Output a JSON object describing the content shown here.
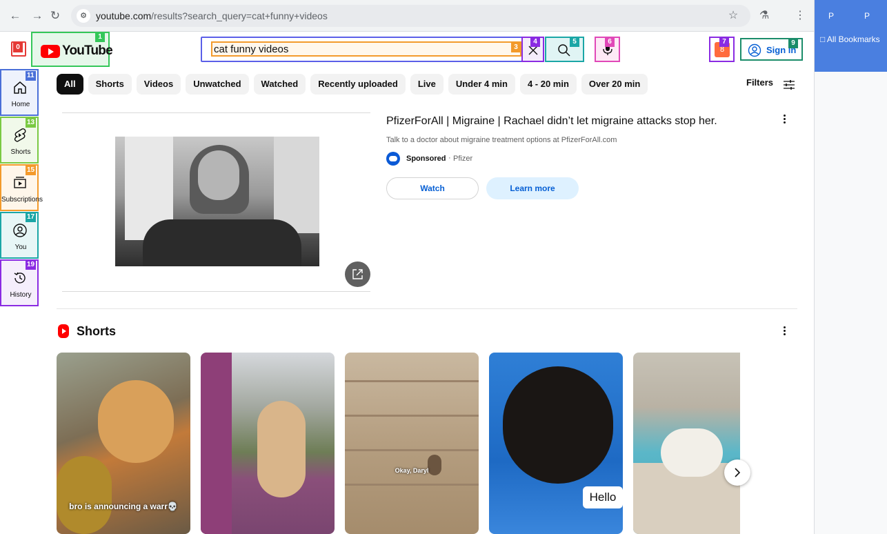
{
  "browser": {
    "url_host": "youtube.com",
    "url_path": "/results?search_query=cat+funny+videos",
    "side_panel": {
      "p_label_1": "P",
      "p_label_2": "P",
      "all_bookmarks": "All Bookmarks"
    }
  },
  "masthead": {
    "logo_text": "YouTube",
    "search": {
      "value": "cat funny videos",
      "placeholder": "Search"
    },
    "signin_label": "Sign in",
    "create_badge_label": "8"
  },
  "badges": {
    "hamburger": "0",
    "logo": "1",
    "search_input": "3",
    "clear": "4",
    "search_btn": "5",
    "mic": "6",
    "create": "7",
    "signin": "9",
    "home": "11",
    "shorts": "13",
    "subscriptions": "15",
    "you": "17",
    "history": "19"
  },
  "guide": {
    "items": [
      {
        "label": "Home",
        "icon": "home-icon"
      },
      {
        "label": "Shorts",
        "icon": "shorts-icon"
      },
      {
        "label": "Subscriptions",
        "icon": "subscriptions-icon"
      },
      {
        "label": "You",
        "icon": "you-icon"
      },
      {
        "label": "History",
        "icon": "history-icon"
      }
    ]
  },
  "chips": [
    "All",
    "Shorts",
    "Videos",
    "Unwatched",
    "Watched",
    "Recently uploaded",
    "Live",
    "Under 4 min",
    "4 - 20 min",
    "Over 20 min"
  ],
  "filters_label": "Filters",
  "ad": {
    "title": "PfizerForAll | Migraine | Rachael didn’t let migraine attacks stop her.",
    "description": "Talk to a doctor about migraine treatment options at PfizerForAll.com",
    "sponsored_label": "Sponsored",
    "separator": "·",
    "advertiser": "Pfizer",
    "watch_label": "Watch",
    "learn_more_label": "Learn more"
  },
  "shorts_shelf": {
    "title": "Shorts",
    "cards": [
      {
        "caption": "bro is announcing a warr💀"
      },
      {
        "caption": ""
      },
      {
        "caption": "Okay, Daryl"
      },
      {
        "caption": "Hello"
      },
      {
        "caption": ""
      }
    ]
  },
  "colors": {
    "brand_red": "#ff0000",
    "link_blue": "#065fd4",
    "chip_active": "#0f0f0f",
    "chip_bg": "#f2f2f2"
  }
}
